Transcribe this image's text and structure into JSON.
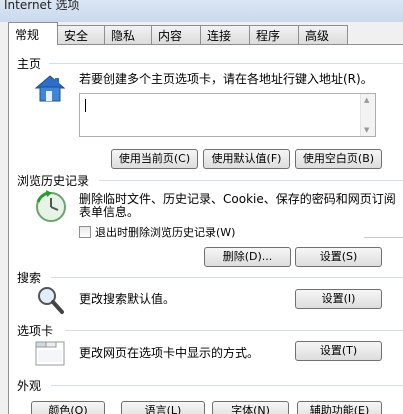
{
  "window": {
    "title": "Internet 选项"
  },
  "tabs": [
    {
      "label": "常规",
      "active": true
    },
    {
      "label": "安全"
    },
    {
      "label": "隐私"
    },
    {
      "label": "内容"
    },
    {
      "label": "连接"
    },
    {
      "label": "程序"
    },
    {
      "label": "高级"
    }
  ],
  "home": {
    "title": "主页",
    "description": "若要创建多个主页选项卡，请在各地址行键入地址(R)。",
    "address_value": "",
    "buttons": {
      "use_current": "使用当前页(C)",
      "use_default": "使用默认值(F)",
      "use_blank": "使用空白页(B)"
    }
  },
  "history": {
    "title": "浏览历史记录",
    "description_line1": "删除临时文件、历史记录、Cookie、保存的密码和网页表单信息。",
    "description_line1_visible": "删除临时文件、历史记录、Cookie、保存的密码和网页订阅",
    "description_line2": "表单信息。",
    "checkbox_label": "退出时删除浏览历史记录(W)",
    "checkbox_checked": false,
    "buttons": {
      "delete": "删除(D)...",
      "settings": "设置(S)"
    }
  },
  "search": {
    "title": "搜索",
    "description": "更改搜索默认值。",
    "buttons": {
      "settings": "设置(I)"
    }
  },
  "tabs_section": {
    "title": "选项卡",
    "description": "更改网页在选项卡中显示的方式。",
    "buttons": {
      "settings": "设置(T)"
    }
  },
  "appearance": {
    "title": "外观",
    "buttons": {
      "colors": "颜色(O)",
      "languages": "语言(L)",
      "fonts": "字体(N)",
      "accessibility": "辅助功能(E)"
    }
  },
  "icons": {
    "home": "house-icon",
    "history": "clock-refresh-icon",
    "search": "magnifier-icon",
    "tabs": "tabbed-window-icon"
  },
  "colors": {
    "accent_blue": "#2c6ec8",
    "border": "#8e8f8f"
  }
}
